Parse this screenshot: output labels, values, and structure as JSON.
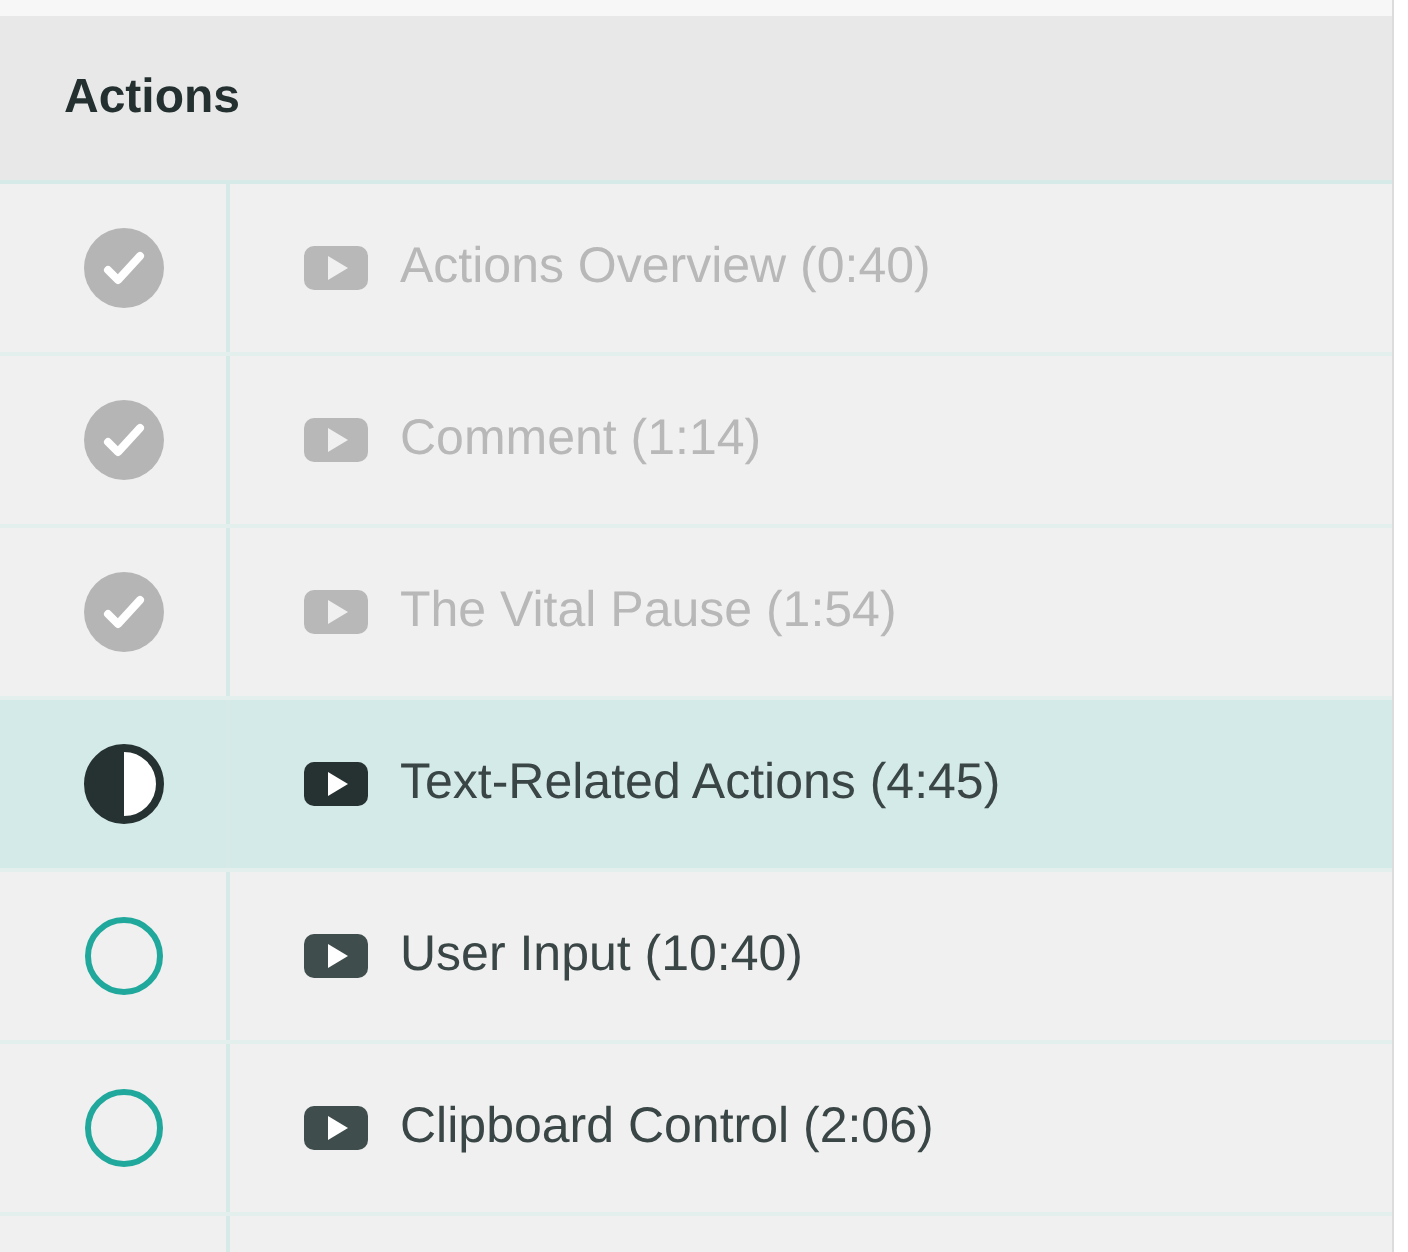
{
  "section": {
    "title": "Actions"
  },
  "lessons": [
    {
      "title": "Actions Overview (0:40)",
      "kind": "done",
      "selected": false
    },
    {
      "title": "Comment (1:14)",
      "kind": "done",
      "selected": false
    },
    {
      "title": "The Vital Pause (1:54)",
      "kind": "done",
      "selected": false
    },
    {
      "title": "Text-Related Actions (4:45)",
      "kind": "current",
      "selected": true
    },
    {
      "title": "User Input (10:40)",
      "kind": "todo",
      "selected": false
    },
    {
      "title": "Clipboard Control (2:06)",
      "kind": "todo",
      "selected": false
    }
  ]
}
